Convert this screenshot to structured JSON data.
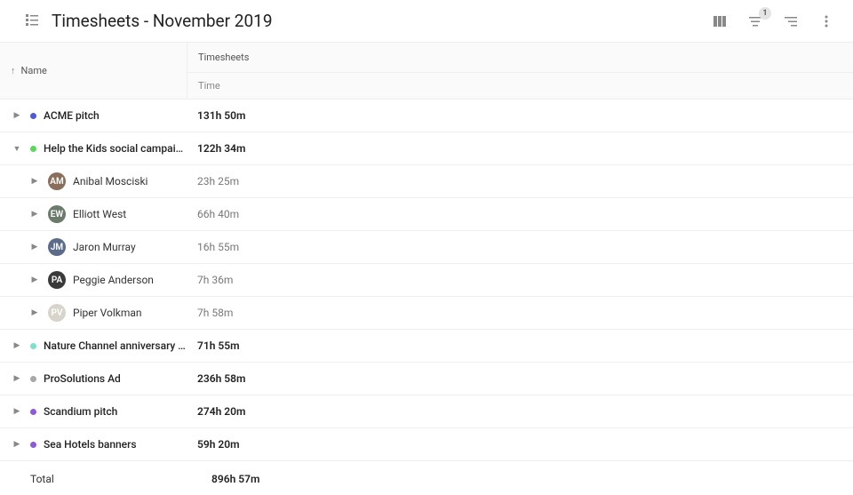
{
  "header": {
    "title": "Timesheets - November 2019",
    "filter_badge": "1"
  },
  "table": {
    "name_column": "Name",
    "timesheets_column": "Timesheets",
    "time_subcolumn": "Time"
  },
  "projects": [
    {
      "name": "ACME pitch",
      "time": "131h 50m",
      "color": "#4b5bd8",
      "expanded": false,
      "members": []
    },
    {
      "name": "Help the Kids social campaign",
      "time": "122h 34m",
      "color": "#5bd85b",
      "expanded": true,
      "members": [
        {
          "name": "Anibal Mosciski",
          "time": "23h 25m",
          "avatar_bg": "#8a6d5b"
        },
        {
          "name": "Elliott West",
          "time": "66h 40m",
          "avatar_bg": "#6b7a6b"
        },
        {
          "name": "Jaron Murray",
          "time": "16h 55m",
          "avatar_bg": "#5b6b8a"
        },
        {
          "name": "Peggie Anderson",
          "time": "7h 36m",
          "avatar_bg": "#3a3a3a"
        },
        {
          "name": "Piper Volkman",
          "time": "7h 58m",
          "avatar_bg": "#d8d4cc"
        }
      ]
    },
    {
      "name": "Nature Channel anniversary cam…",
      "time": "71h 55m",
      "color": "#7fe0cb",
      "expanded": false,
      "members": []
    },
    {
      "name": "ProSolutions Ad",
      "time": "236h 58m",
      "color": "#a8a8a8",
      "expanded": false,
      "members": []
    },
    {
      "name": "Scandium pitch",
      "time": "274h 20m",
      "color": "#8b5bd8",
      "expanded": false,
      "members": []
    },
    {
      "name": "Sea Hotels banners",
      "time": "59h 20m",
      "color": "#8b5bd8",
      "expanded": false,
      "members": []
    }
  ],
  "total": {
    "label": "Total",
    "time": "896h 57m"
  }
}
